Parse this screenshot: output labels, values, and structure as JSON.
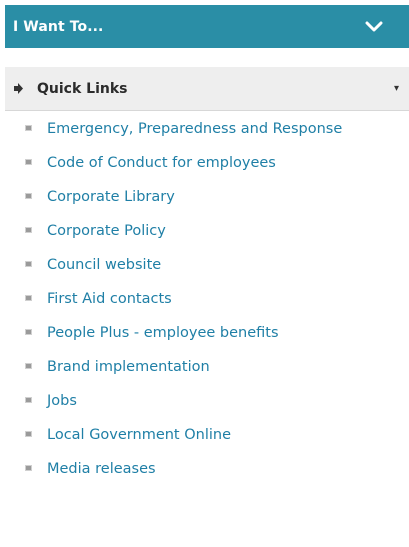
{
  "header": {
    "title": "I Want To...",
    "icon": "chevron-down-icon"
  },
  "quick_links": {
    "label": "Quick Links",
    "items": [
      "Emergency, Preparedness and Response",
      "Code of Conduct for employees",
      "Corporate Library",
      "Corporate Policy",
      "Council website",
      "First Aid contacts",
      "People Plus - employee benefits",
      "Brand implementation",
      "Jobs",
      "Local Government Online",
      "Media releases"
    ]
  },
  "colors": {
    "header_bg": "#2a8ea6",
    "link": "#1f7fa6",
    "section_bg": "#eeeeee"
  }
}
